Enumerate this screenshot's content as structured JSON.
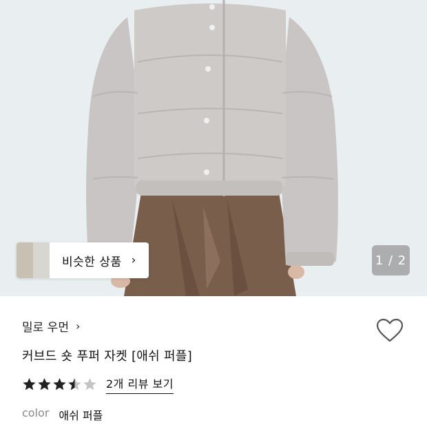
{
  "gallery": {
    "similar_label": "비슷한 상품",
    "page_indicator": "1 / 2"
  },
  "product": {
    "brand": "밀로 우먼",
    "name": "커브드 숏 푸퍼 자켓 [애쉬 퍼플]",
    "rating": 3.5,
    "rating_max": 5,
    "review_link": "2개 리뷰 보기",
    "color_label": "color",
    "color_value": "애쉬 퍼플"
  },
  "colors": {
    "star_filled": "#222222",
    "star_empty": "#c4c4c4",
    "jacket": "#cdcac8",
    "skirt": "#7a5e4c",
    "hero_bg": "#e9eef0"
  },
  "icons": {
    "wishlist": "heart-outline-icon",
    "chevron": "chevron-right-icon"
  }
}
